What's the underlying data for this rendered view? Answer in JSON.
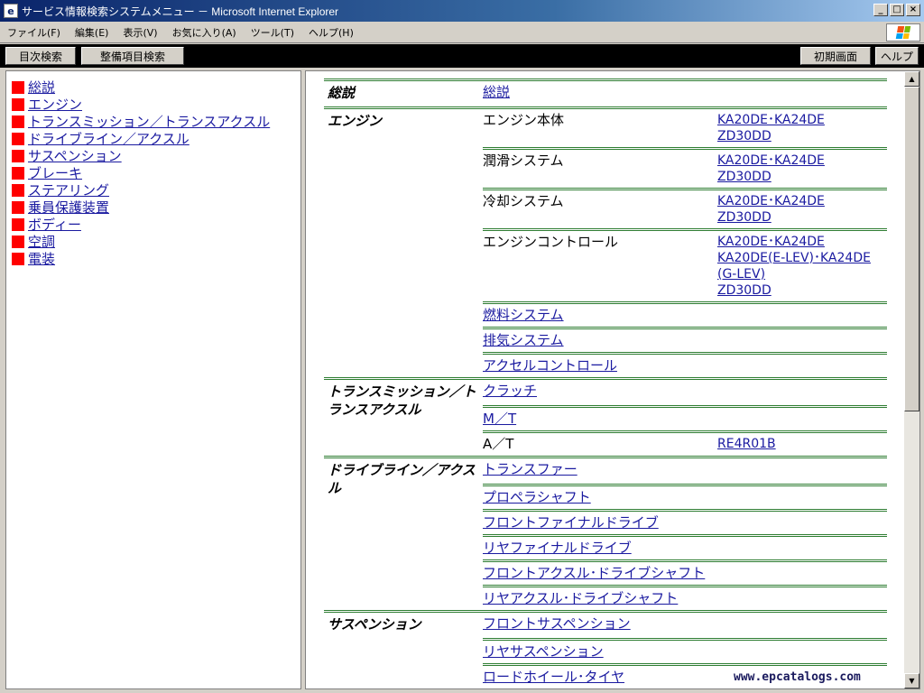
{
  "window": {
    "title": "サービス情報検索システムメニュー － Microsoft Internet Explorer"
  },
  "menubar": {
    "items": [
      "ファイル(F)",
      "編集(E)",
      "表示(V)",
      "お気に入り(A)",
      "ツール(T)",
      "ヘルプ(H)"
    ]
  },
  "navbar": {
    "toc": "目次検索",
    "maintenance": "整備項目検索",
    "home": "初期画面",
    "help": "ヘルプ"
  },
  "left_items": [
    "総説",
    "エンジン",
    "トランスミッション／トランスアクスル",
    "ドライブライン／アクスル",
    "サスペンション",
    "ブレーキ",
    "ステアリング",
    "乗員保護装置",
    "ボディー",
    "空調",
    "電装"
  ],
  "groups": [
    {
      "category": "総説",
      "rows": [
        {
          "sub": "総説",
          "sub_link": true,
          "models": []
        }
      ]
    },
    {
      "category": "エンジン",
      "rows": [
        {
          "sub": "エンジン本体",
          "sub_link": false,
          "models": [
            "KA20DE･KA24DE",
            "ZD30DD"
          ]
        },
        {
          "sub": "潤滑システム",
          "sub_link": false,
          "models": [
            "KA20DE･KA24DE",
            "ZD30DD"
          ]
        },
        {
          "sub": "冷却システム",
          "sub_link": false,
          "models": [
            "KA20DE･KA24DE",
            "ZD30DD"
          ]
        },
        {
          "sub": "エンジンコントロール",
          "sub_link": false,
          "models": [
            "KA20DE･KA24DE",
            "KA20DE(E-LEV)･KA24DE",
            "(G-LEV)",
            "ZD30DD"
          ]
        },
        {
          "sub": "燃料システム",
          "sub_link": true,
          "models": []
        },
        {
          "sub": "排気システム",
          "sub_link": true,
          "models": []
        },
        {
          "sub": "アクセルコントロール",
          "sub_link": true,
          "models": []
        }
      ]
    },
    {
      "category": "トランスミッション／トランスアクスル",
      "rows": [
        {
          "sub": "クラッチ",
          "sub_link": true,
          "models": []
        },
        {
          "sub": "M／T",
          "sub_link": true,
          "models": []
        },
        {
          "sub": "A／T",
          "sub_link": false,
          "models": [
            "RE4R01B"
          ]
        }
      ]
    },
    {
      "category": "ドライブライン／アクスル",
      "rows": [
        {
          "sub": "トランスファー",
          "sub_link": true,
          "models": []
        },
        {
          "sub": "プロペラシャフト",
          "sub_link": true,
          "models": []
        },
        {
          "sub": "フロントファイナルドライブ",
          "sub_link": true,
          "models": []
        },
        {
          "sub": "リヤファイナルドライブ",
          "sub_link": true,
          "models": []
        },
        {
          "sub": "フロントアクスル･ドライブシャフト",
          "sub_link": true,
          "models": []
        },
        {
          "sub": "リヤアクスル･ドライブシャフト",
          "sub_link": true,
          "models": []
        }
      ]
    },
    {
      "category": "サスペンション",
      "rows": [
        {
          "sub": "フロントサスペンション",
          "sub_link": true,
          "models": []
        },
        {
          "sub": "リヤサスペンション",
          "sub_link": true,
          "models": []
        },
        {
          "sub": "ロードホイール･タイヤ",
          "sub_link": true,
          "models": []
        }
      ]
    }
  ],
  "watermark": "www.epcatalogs.com"
}
